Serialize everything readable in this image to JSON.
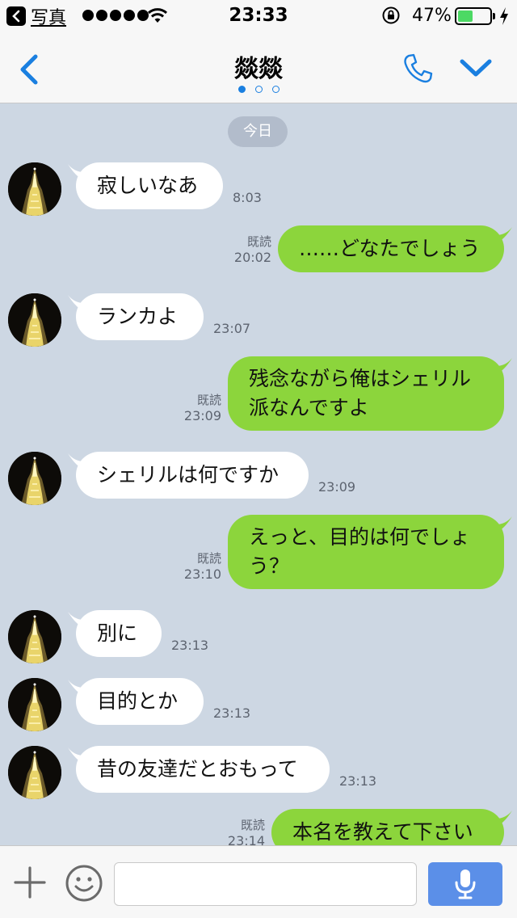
{
  "status_bar": {
    "back_app_label": "写真",
    "time": "23:33",
    "battery_percent": "47%",
    "battery_level": 0.47,
    "battery_color": "#4cd964"
  },
  "header": {
    "title": "燚燚",
    "page_dots": 3,
    "active_dot": 0,
    "icons": [
      "back-chevron-icon",
      "phone-icon",
      "chevron-down-icon"
    ],
    "accent_color": "#1a7fe0"
  },
  "chat": {
    "date_label": "今日",
    "incoming_bubble_color": "#ffffff",
    "outgoing_bubble_color": "#8cd53c",
    "background_color": "#cdd7e3",
    "messages": [
      {
        "direction": "in",
        "text": "寂しいなあ",
        "time": "8:03"
      },
      {
        "direction": "out",
        "text": "……どなたでしょう",
        "read": "既読",
        "time": "20:02"
      },
      {
        "direction": "in",
        "text": "ランカよ",
        "time": "23:07"
      },
      {
        "direction": "out",
        "text": "残念ながら俺はシェリル派なんですよ",
        "read": "既読",
        "time": "23:09"
      },
      {
        "direction": "in",
        "text": "シェリルは何ですか",
        "time": "23:09"
      },
      {
        "direction": "out",
        "text": "えっと、目的は何でしょう？",
        "read": "既読",
        "time": "23:10"
      },
      {
        "direction": "in",
        "text": "別に",
        "time": "23:13"
      },
      {
        "direction": "in",
        "text": "目的とか",
        "time": "23:13"
      },
      {
        "direction": "in",
        "text": "昔の友達だとおもって",
        "time": "23:13"
      },
      {
        "direction": "out",
        "text": "本名を教えて下さい",
        "read": "既読",
        "time": "23:14"
      }
    ]
  },
  "input_bar": {
    "placeholder": "",
    "icons": [
      "plus-icon",
      "emoji-icon",
      "microphone-icon"
    ],
    "mic_button_color": "#5b8fe8"
  }
}
